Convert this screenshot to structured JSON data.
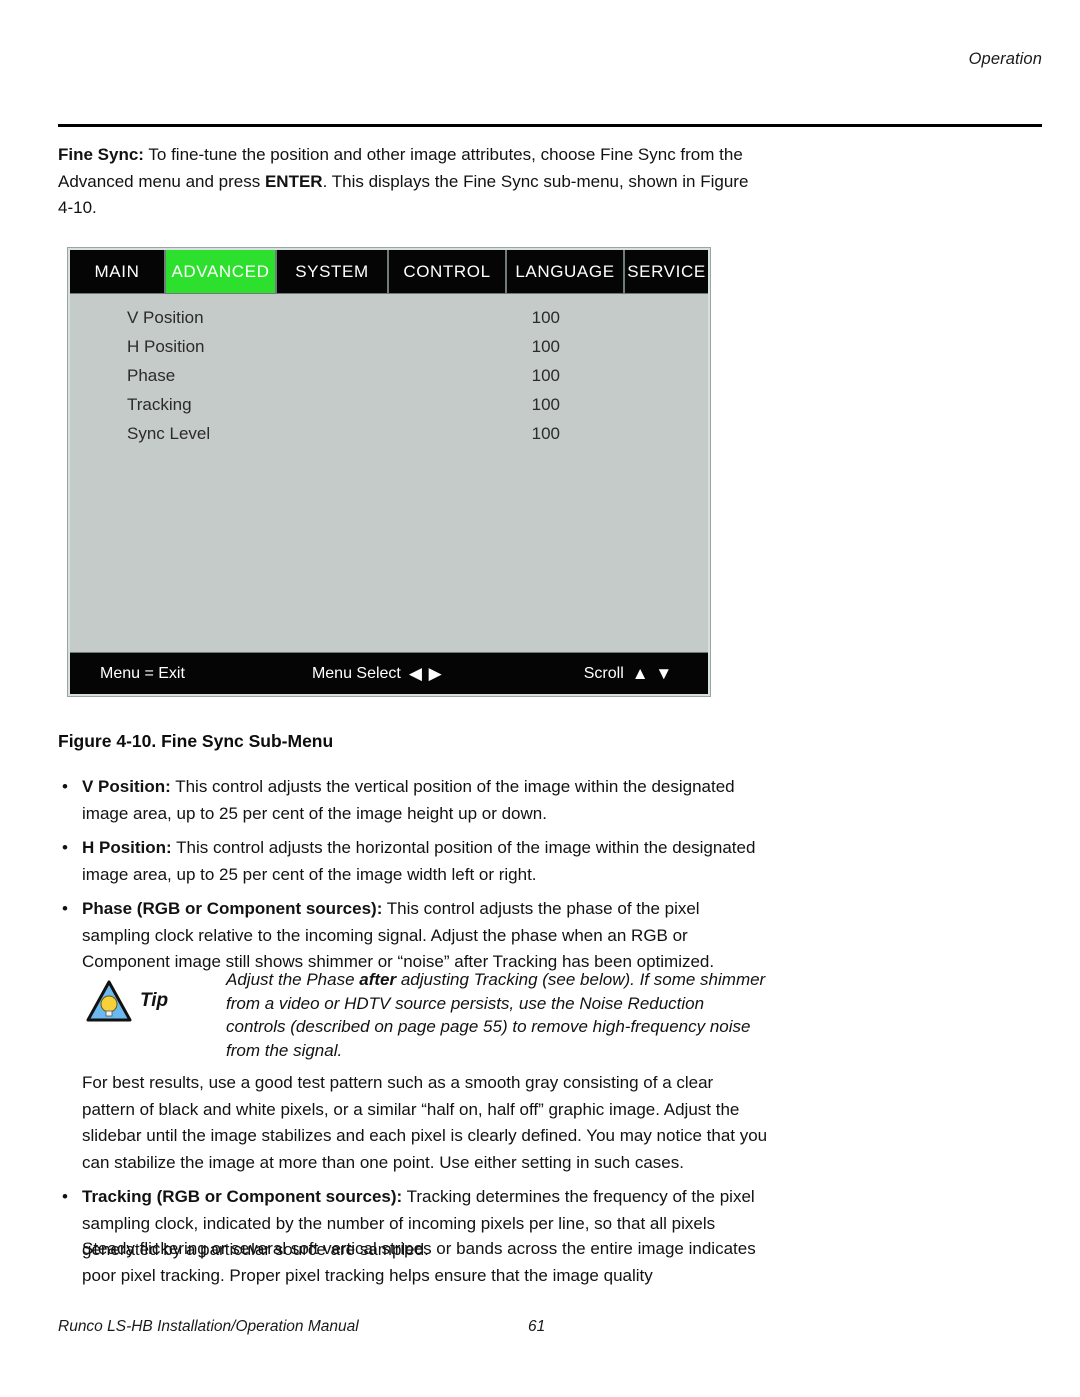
{
  "page": {
    "running_head": "Operation",
    "footer_title": "Runco LS-HB Installation/Operation Manual",
    "footer_page_number": "61"
  },
  "intro": {
    "lead_label": "Fine Sync:",
    "text_part1": " To fine-tune the position and other image attributes, choose Fine Sync from the Advanced menu and press ",
    "emphasis": "ENTER",
    "text_part2": ". This displays the Fine Sync sub-menu, shown in Figure 4-10."
  },
  "osd": {
    "accent_color": "#2ee02e",
    "body_color": "#c4cbc9",
    "bar_color": "#050505",
    "tabs": [
      {
        "label": "MAIN",
        "active": false
      },
      {
        "label": "ADVANCED",
        "active": true
      },
      {
        "label": "SYSTEM",
        "active": false
      },
      {
        "label": "CONTROL",
        "active": false
      },
      {
        "label": "LANGUAGE",
        "active": false
      },
      {
        "label": "SERVICE",
        "active": false
      }
    ],
    "rows": [
      {
        "label": "V Position",
        "value": "100"
      },
      {
        "label": "H Position",
        "value": "100"
      },
      {
        "label": "Phase",
        "value": "100"
      },
      {
        "label": "Tracking",
        "value": "100"
      },
      {
        "label": "Sync Level",
        "value": "100"
      }
    ],
    "footer": {
      "exit_label": "Menu = Exit",
      "select_label": "Menu Select",
      "select_arrows": "◀ ▶",
      "scroll_label": "Scroll",
      "scroll_arrows": "▲ ▼"
    }
  },
  "figure": {
    "caption": "Figure 4-10. Fine Sync Sub-Menu"
  },
  "bullets": [
    {
      "marker": "•",
      "term": "V Position:",
      "text": " This control adjusts the vertical position of the image within the designated image area, up to 25 per cent of the image height up or down."
    },
    {
      "marker": "•",
      "term": "H Position:",
      "text": " This control adjusts the horizontal position of the image within the designated image area, up to 25 per cent of the image width left or right."
    },
    {
      "marker": "•",
      "term": "Phase (RGB or Component sources):",
      "text": " This control adjusts the phase of the pixel sampling clock relative to the incoming signal. Adjust the phase when an RGB or Component image still shows shimmer or “noise” after Tracking has been optimized."
    }
  ],
  "tip": {
    "label": "Tip",
    "icon": "lightbulb-triangle-icon",
    "triangle_color": "#6bb9f0",
    "bulb_color": "#f7d13a",
    "text_part1": "Adjust the Phase ",
    "emphasis": "after",
    "text_part2": " adjusting Tracking (see below). If some shimmer from a video or HDTV source persists, use the Noise Reduction controls (described on page page 55) to remove high-frequency noise from the signal."
  },
  "body": {
    "best_results": "For best results, use a good test pattern such as a smooth gray consisting of a clear pattern of black and white pixels, or a similar “half on, half off” graphic image. Adjust the slidebar until the image stabilizes and each pixel is clearly defined. You may notice that you can stabilize the image at more than one point. Use either setting in such cases.",
    "tracking_bullet": {
      "marker": "•",
      "term": "Tracking (RGB or Component sources):",
      "text": " Tracking determines the frequency of the pixel sampling clock, indicated by the number of incoming pixels per line, so that all pixels generated by a particular source are sampled."
    },
    "steady_flicker": "Steady flickering or several soft vertical stripes or bands across the entire image indicates poor pixel tracking. Proper pixel tracking helps ensure that the image quality"
  }
}
